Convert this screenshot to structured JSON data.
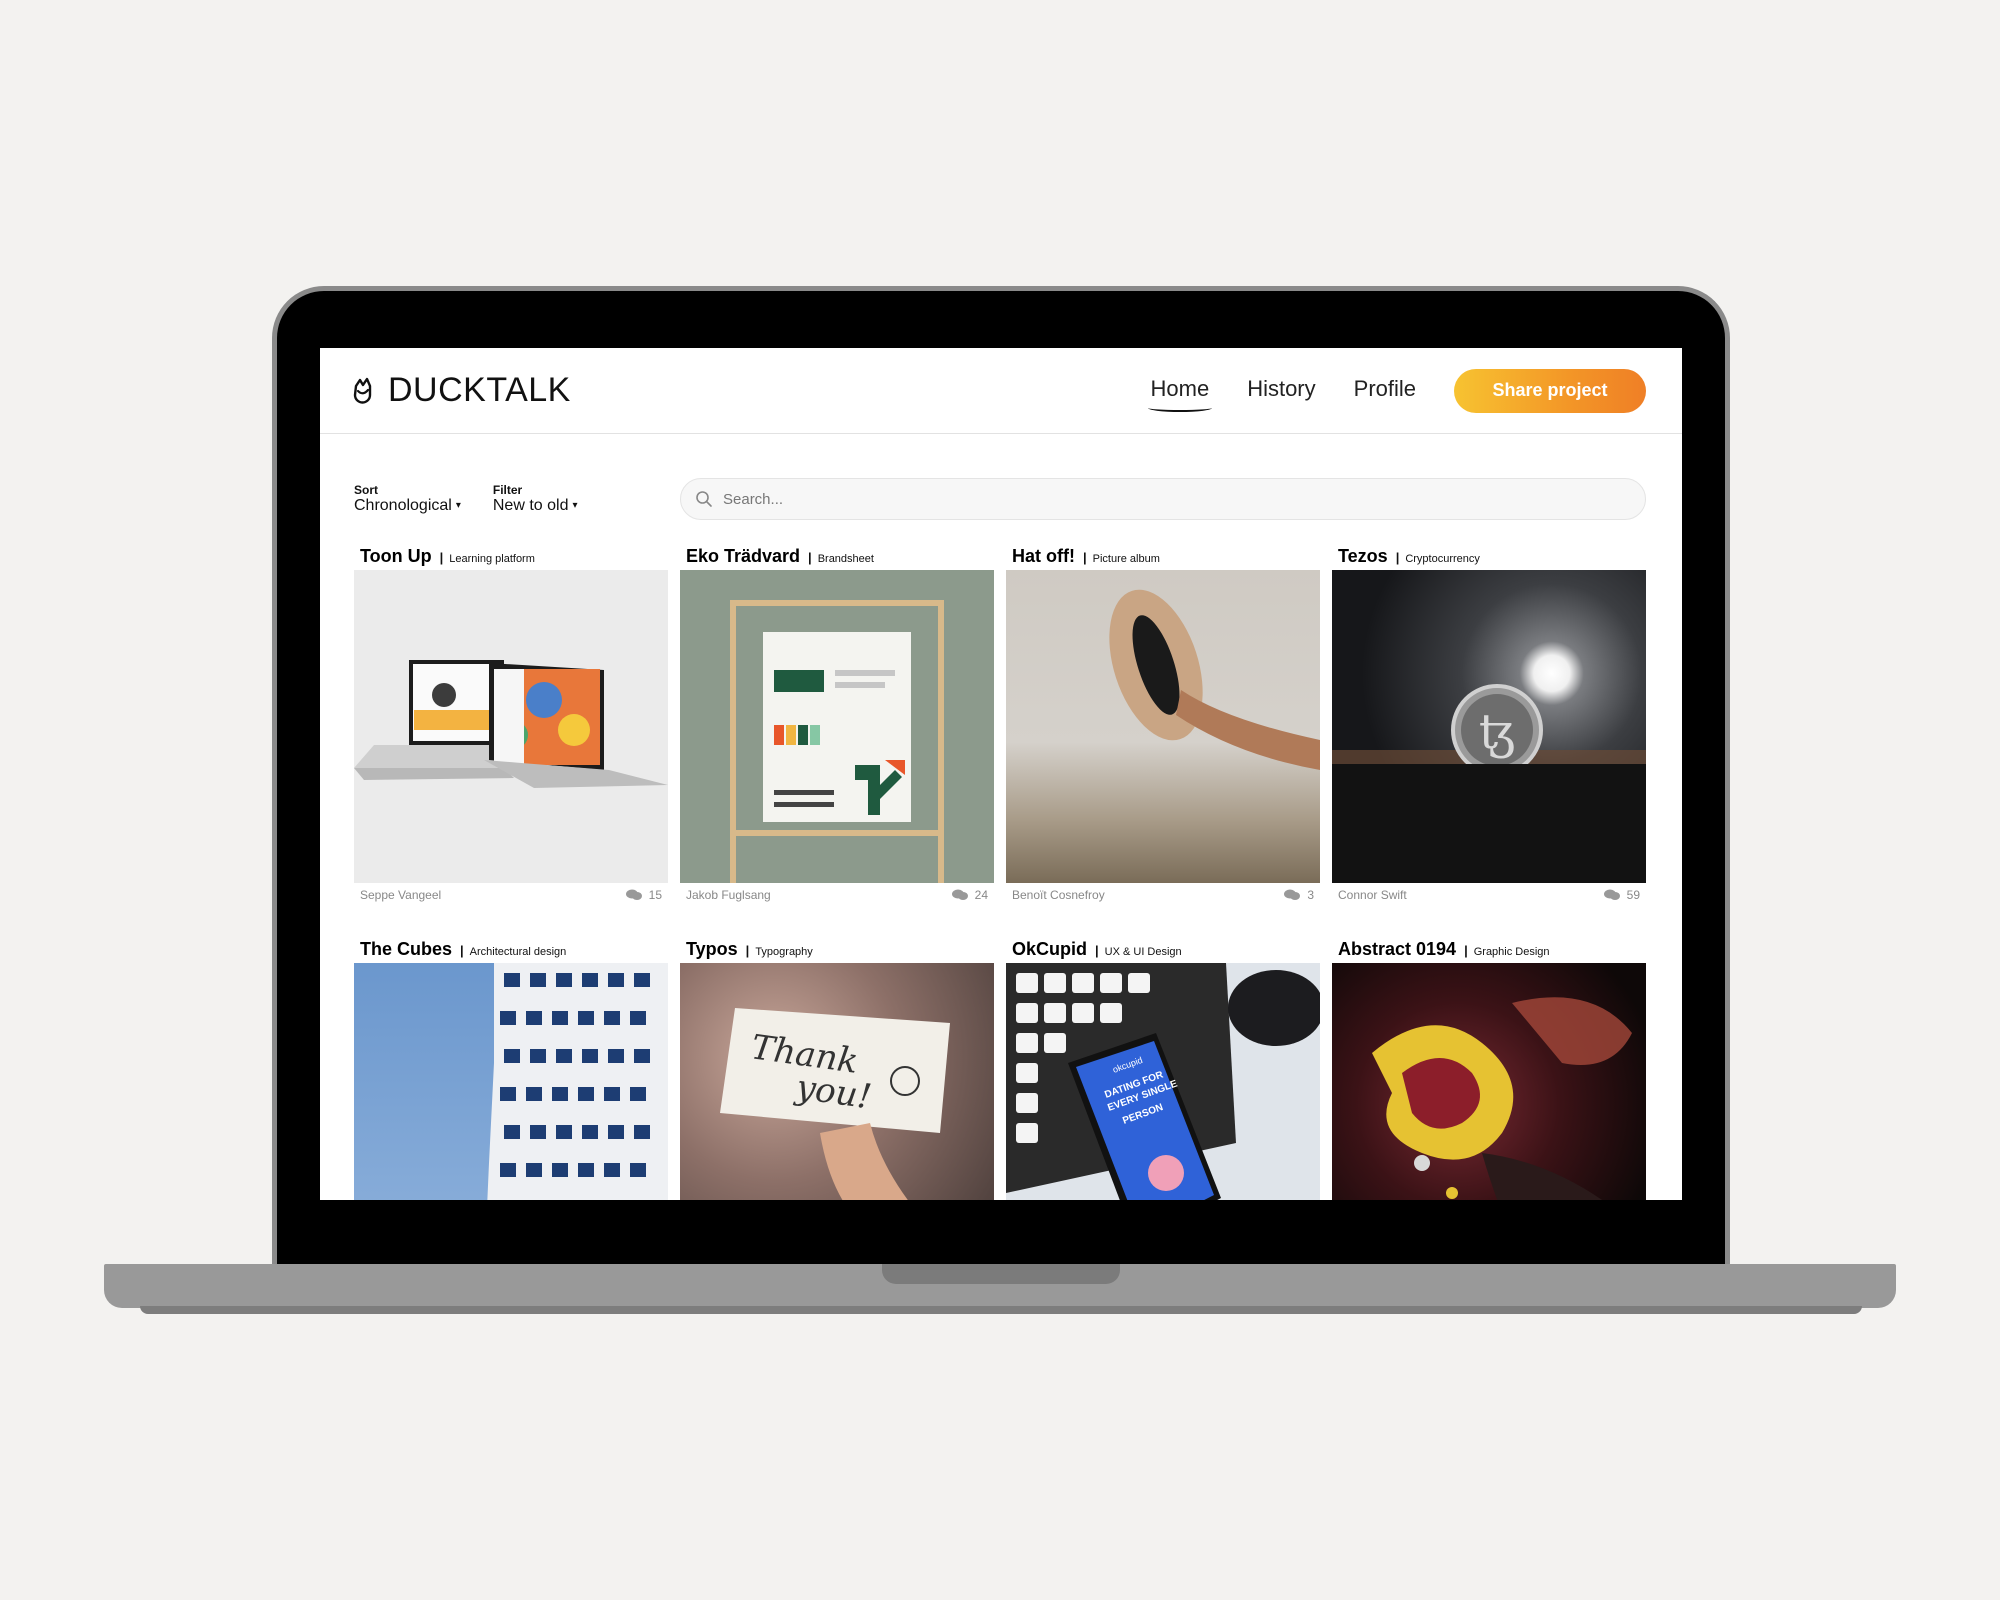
{
  "app": {
    "name": "DUCKTALK",
    "logo_icon": "duck-tulip-icon"
  },
  "nav": {
    "items": [
      {
        "label": "Home",
        "active": true
      },
      {
        "label": "History",
        "active": false
      },
      {
        "label": "Profile",
        "active": false
      }
    ],
    "share_label": "Share project"
  },
  "controls": {
    "sort": {
      "label": "Sort",
      "value": "Chronological"
    },
    "filter": {
      "label": "Filter",
      "value": "New to old"
    }
  },
  "search": {
    "placeholder": "Search..."
  },
  "colors": {
    "accent_start": "#f7c331",
    "accent_end": "#ef7f26"
  },
  "projects": [
    {
      "title": "Toon Up",
      "category": "Learning platform",
      "author": "Seppe Vangeel",
      "comments": "15",
      "image": "laptops-mockup"
    },
    {
      "title": "Eko Trädvard",
      "category": "Brandsheet",
      "author": "Jakob Fuglsang",
      "comments": "24",
      "image": "brandsheet-poster"
    },
    {
      "title": "Hat off!",
      "category": "Picture album",
      "author": "Benoït Cosnefroy",
      "comments": "3",
      "image": "hand-holding-hat"
    },
    {
      "title": "Tezos",
      "category": "Cryptocurrency",
      "author": "Connor Swift",
      "comments": "59",
      "image": "tezos-coin"
    },
    {
      "title": "The Cubes",
      "category": "Architectural design",
      "image": "tower-building"
    },
    {
      "title": "Typos",
      "category": "Typography",
      "image": "thank-you-card",
      "card_text": [
        "Thank",
        "you!"
      ]
    },
    {
      "title": "OkCupid",
      "category": "UX & UI Design",
      "image": "phone-on-keyboard",
      "phone_text": [
        "okcupid",
        "DATING FOR",
        "EVERY SINGLE",
        "PERSON"
      ]
    },
    {
      "title": "Abstract 0194",
      "category": "Graphic Design",
      "image": "fluid-abstract"
    }
  ]
}
